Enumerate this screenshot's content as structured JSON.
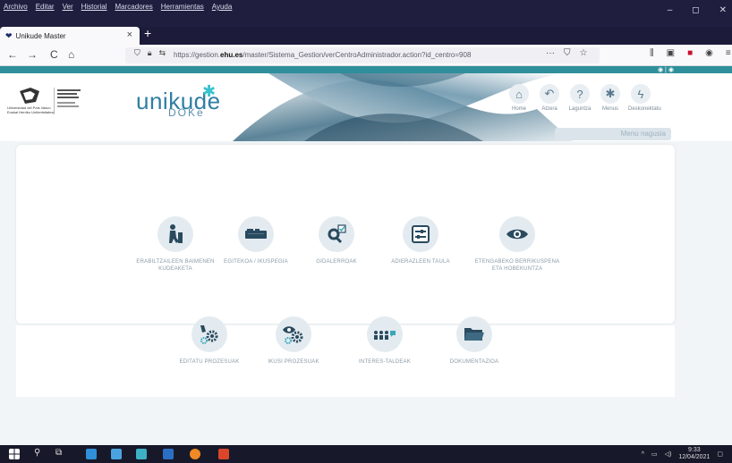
{
  "menubar": {
    "items": [
      "Archivo",
      "Editar",
      "Ver",
      "Historial",
      "Marcadores",
      "Herramientas",
      "Ayuda"
    ]
  },
  "tab": {
    "title": "Unikude Master",
    "close": "×",
    "new_tab": "+"
  },
  "navbar": {
    "back": "←",
    "forward": "→",
    "reload": "C",
    "home": "⌂",
    "url_prefix": "https://gestion.",
    "url_domain": "ehu.es",
    "url_rest": "/master/Sistema_Gestion/verCentroAdministrador.action?id_centro=908",
    "more": "···"
  },
  "header": {
    "lang": "◉ | ◉",
    "upv_text": "Universidad del País Vasco  Euskal Herriko Unibertsitatea",
    "brand": "unikude",
    "brand_star": "✱",
    "brand_sub": "DOKe",
    "topnav": [
      {
        "label": "Home",
        "icon": "⌂"
      },
      {
        "label": "Atzera",
        "icon": "↶"
      },
      {
        "label": "Laguntza",
        "icon": "?"
      },
      {
        "label": "Menus",
        "icon": "✱"
      },
      {
        "label": "Deskonektatu",
        "icon": "ϟ"
      }
    ],
    "menu_tab": "Menu nagusia"
  },
  "main": {
    "row1": [
      {
        "label": "ERABILTZAILEEN BAIMENEN KUDEAKETA",
        "icon": "user-icon"
      },
      {
        "label": "EGITEKOA / IKUSPEGIA",
        "icon": "books-icon"
      },
      {
        "label": "GIDALERROAK",
        "icon": "search-doc-icon"
      },
      {
        "label": "ADIERAZLEEN TAULA",
        "icon": "sliders-icon"
      },
      {
        "label": "ETENGABEKO BERRIKUSPENA ETA HOBEKUNTZA",
        "icon": "eye-icon"
      }
    ],
    "row2": [
      {
        "label": "EDITATU PROZESUAK",
        "icon": "edit-gear-icon"
      },
      {
        "label": "IKUSI PROZESUAK",
        "icon": "view-gear-icon"
      },
      {
        "label": "INTERES-TALDEAK",
        "icon": "group-icon"
      },
      {
        "label": "DOKUMENTAZIOA",
        "icon": "folder-icon"
      }
    ]
  },
  "taskbar": {
    "time": "9:33",
    "date": "12/04/2021"
  },
  "colors": {
    "accent": "#2e8f9a",
    "brand": "#2f7ea3",
    "icon_dark": "#2a4a5e",
    "icon_teal": "#3aa6b9"
  }
}
